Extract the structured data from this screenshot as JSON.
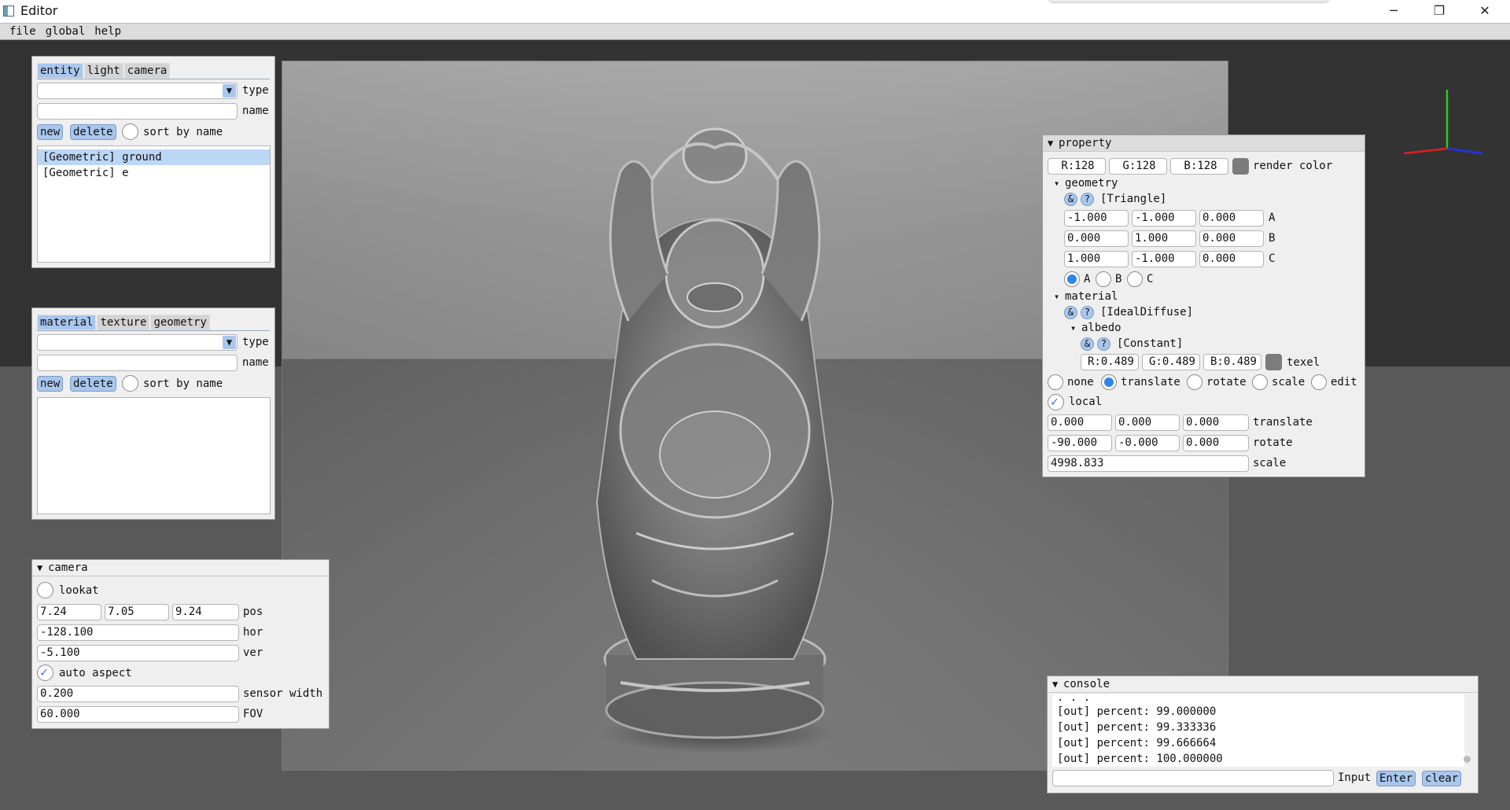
{
  "window": {
    "title": "Editor",
    "minimize": "─",
    "maximize": "❐",
    "close": "✕"
  },
  "menu": [
    "file",
    "global",
    "help"
  ],
  "entity_panel": {
    "tabs": [
      "entity",
      "light",
      "camera"
    ],
    "type_label": "type",
    "name_label": "name",
    "new_label": "new",
    "delete_label": "delete",
    "sort_label": "sort by name",
    "items": [
      "[Geometric] ground",
      "[Geometric] e"
    ]
  },
  "material_panel": {
    "tabs": [
      "material",
      "texture",
      "geometry"
    ],
    "type_label": "type",
    "name_label": "name",
    "new_label": "new",
    "delete_label": "delete",
    "sort_label": "sort by name"
  },
  "camera_panel": {
    "title": "camera",
    "lookat_label": "lookat",
    "pos": [
      "7.24",
      "7.05",
      "9.24"
    ],
    "pos_label": "pos",
    "hor": "-128.100",
    "hor_label": "hor",
    "ver": "-5.100",
    "ver_label": "ver",
    "auto_aspect_label": "auto aspect",
    "sensor_width": "0.200",
    "sensor_width_label": "sensor width",
    "fov": "60.000",
    "fov_label": "FOV"
  },
  "property_panel": {
    "title": "property",
    "render_color": [
      "R:128",
      "G:128",
      "B:128"
    ],
    "render_color_label": "render color",
    "geometry_label": "geometry",
    "geometry_type": "[Triangle]",
    "A": [
      "-1.000",
      "-1.000",
      "0.000"
    ],
    "B": [
      "0.000",
      "1.000",
      "0.000"
    ],
    "C": [
      "1.000",
      "-1.000",
      "0.000"
    ],
    "A_label": "A",
    "B_label": "B",
    "C_label": "C",
    "material_label": "material",
    "material_type": "[IdealDiffuse]",
    "albedo_label": "albedo",
    "albedo_type": "[Constant]",
    "texel": [
      "R:0.489",
      "G:0.489",
      "B:0.489"
    ],
    "texel_label": "texel",
    "modes": [
      "none",
      "translate",
      "rotate",
      "scale",
      "edit"
    ],
    "local_label": "local",
    "translate": [
      "0.000",
      "0.000",
      "0.000"
    ],
    "translate_label": "translate",
    "rotate": [
      "-90.000",
      "-0.000",
      "0.000"
    ],
    "rotate_label": "rotate",
    "scale": "4998.833",
    "scale_label": "scale",
    "amp": "&",
    "question": "?"
  },
  "console": {
    "title": "console",
    "partial": ". . .",
    "lines": [
      "[out] percent: 99.000000",
      "[out] percent: 99.333336",
      "[out] percent: 99.666664",
      "[out] percent: 100.000000"
    ],
    "input_label": "Input",
    "enter_label": "Enter",
    "clear_label": "clear"
  },
  "colors": {
    "accent": "#a9c7ee",
    "selection": "#bcd6f6",
    "radio_on": "#2f86e8",
    "viewport": "#333333"
  }
}
